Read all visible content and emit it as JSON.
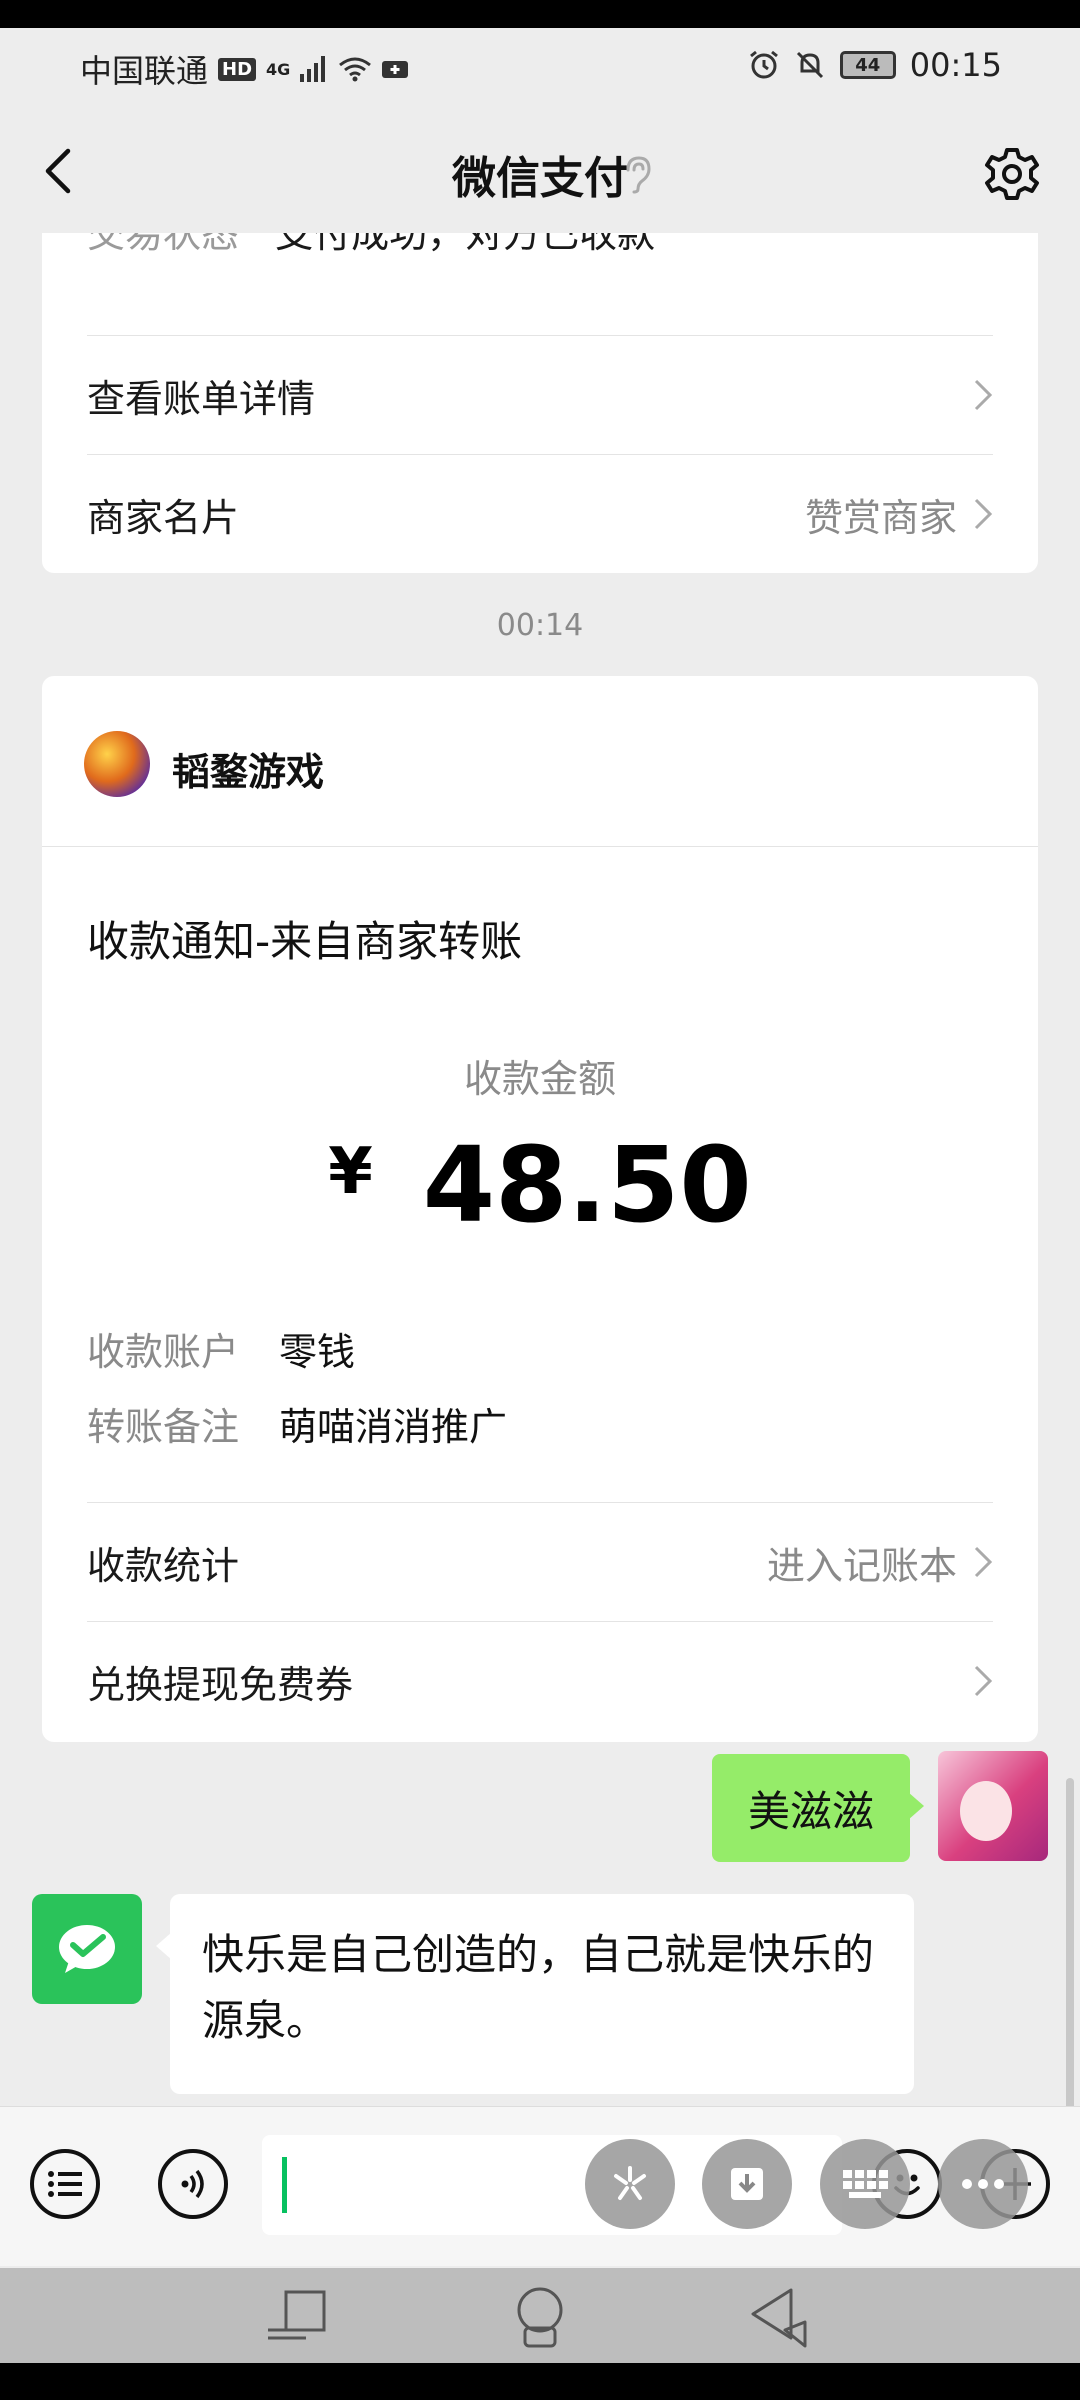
{
  "status_bar": {
    "carrier": "中国联通",
    "hd": "HD",
    "network": "4G",
    "battery": "44",
    "time": "00:15"
  },
  "nav": {
    "title": "微信支付"
  },
  "card1": {
    "cutoff_label": "交易状态",
    "cutoff_value": "支付成功，对方已收款",
    "rows": [
      {
        "label": "查看账单详情",
        "right": ""
      },
      {
        "label": "商家名片",
        "right": "赞赏商家"
      }
    ]
  },
  "timestamp": "00:14",
  "card2": {
    "merchant": "韬鍪游戏",
    "notice_title": "收款通知-来自商家转账",
    "amount_label": "收款金额",
    "currency": "¥",
    "amount": "48.50",
    "details": [
      {
        "key": "收款账户",
        "value": "零钱"
      },
      {
        "key": "转账备注",
        "value": "萌喵消消推广"
      }
    ],
    "rows": [
      {
        "label": "收款统计",
        "right": "进入记账本"
      },
      {
        "label": "兑换提现免费券",
        "right": ""
      }
    ]
  },
  "chat": {
    "outgoing": "美滋滋",
    "incoming": "快乐是自己创造的，自己就是快乐的源泉。"
  },
  "colors": {
    "wechat_green": "#07c160",
    "bubble_green": "#95ec69",
    "background": "#ededed"
  },
  "icons": [
    "back-arrow-icon",
    "ear-icon",
    "gear-icon",
    "chevron-right-icon",
    "list-icon",
    "voice-icon",
    "emoji-icon",
    "plus-icon",
    "download-icon",
    "keyboard-icon",
    "more-icon",
    "recent-apps-icon",
    "home-icon",
    "back-triangle-icon"
  ]
}
